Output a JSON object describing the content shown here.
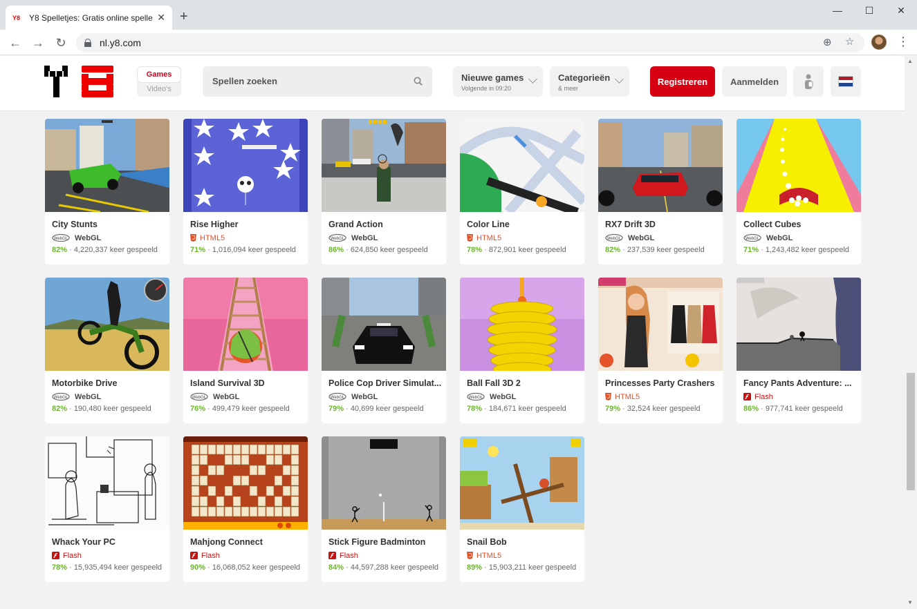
{
  "browser": {
    "tab_title": "Y8 Spelletjes: Gratis online spelle",
    "url": "nl.y8.com"
  },
  "header": {
    "nav_games": "Games",
    "nav_videos": "Video's",
    "search_placeholder": "Spellen zoeken",
    "new_games": "Nieuwe games",
    "new_games_sub": "Volgende in 09:20",
    "categories": "Categorieën",
    "categories_sub": "& meer",
    "register": "Registreren",
    "login": "Aanmelden"
  },
  "games": [
    {
      "title": "City Stunts",
      "tech": "WebGL",
      "rating": "82%",
      "plays": "4,220,337 keer gespeeld"
    },
    {
      "title": "Rise Higher",
      "tech": "HTML5",
      "rating": "71%",
      "plays": "1,016,094 keer gespeeld"
    },
    {
      "title": "Grand Action",
      "tech": "WebGL",
      "rating": "86%",
      "plays": "624,850 keer gespeeld"
    },
    {
      "title": "Color Line",
      "tech": "HTML5",
      "rating": "78%",
      "plays": "872,901 keer gespeeld"
    },
    {
      "title": "RX7 Drift 3D",
      "tech": "WebGL",
      "rating": "82%",
      "plays": "237,539 keer gespeeld"
    },
    {
      "title": "Collect Cubes",
      "tech": "WebGL",
      "rating": "71%",
      "plays": "1,243,482 keer gespeeld"
    },
    {
      "title": "Motorbike Drive",
      "tech": "WebGL",
      "rating": "82%",
      "plays": "190,480 keer gespeeld"
    },
    {
      "title": "Island Survival 3D",
      "tech": "WebGL",
      "rating": "76%",
      "plays": "499,479 keer gespeeld"
    },
    {
      "title": "Police Cop Driver Simulat...",
      "tech": "WebGL",
      "rating": "79%",
      "plays": "40,699 keer gespeeld"
    },
    {
      "title": "Ball Fall 3D 2",
      "tech": "WebGL",
      "rating": "78%",
      "plays": "184,671 keer gespeeld"
    },
    {
      "title": "Princesses Party Crashers",
      "tech": "HTML5",
      "rating": "79%",
      "plays": "32,524 keer gespeeld"
    },
    {
      "title": "Fancy Pants Adventure: ...",
      "tech": "Flash",
      "rating": "86%",
      "plays": "977,741 keer gespeeld"
    },
    {
      "title": "Whack Your PC",
      "tech": "Flash",
      "rating": "78%",
      "plays": "15,935,494 keer gespeeld"
    },
    {
      "title": "Mahjong Connect",
      "tech": "Flash",
      "rating": "90%",
      "plays": "16,068,052 keer gespeeld"
    },
    {
      "title": "Stick Figure Badminton",
      "tech": "Flash",
      "rating": "84%",
      "plays": "44,597,288 keer gespeeld"
    },
    {
      "title": "Snail Bob",
      "tech": "HTML5",
      "rating": "89%",
      "plays": "15,903,211 keer gespeeld"
    }
  ],
  "colors": {
    "brand_red": "#d60012",
    "rating_green": "#6cb52d",
    "html5_orange": "#e34f26",
    "flash_red": "#c81111"
  }
}
